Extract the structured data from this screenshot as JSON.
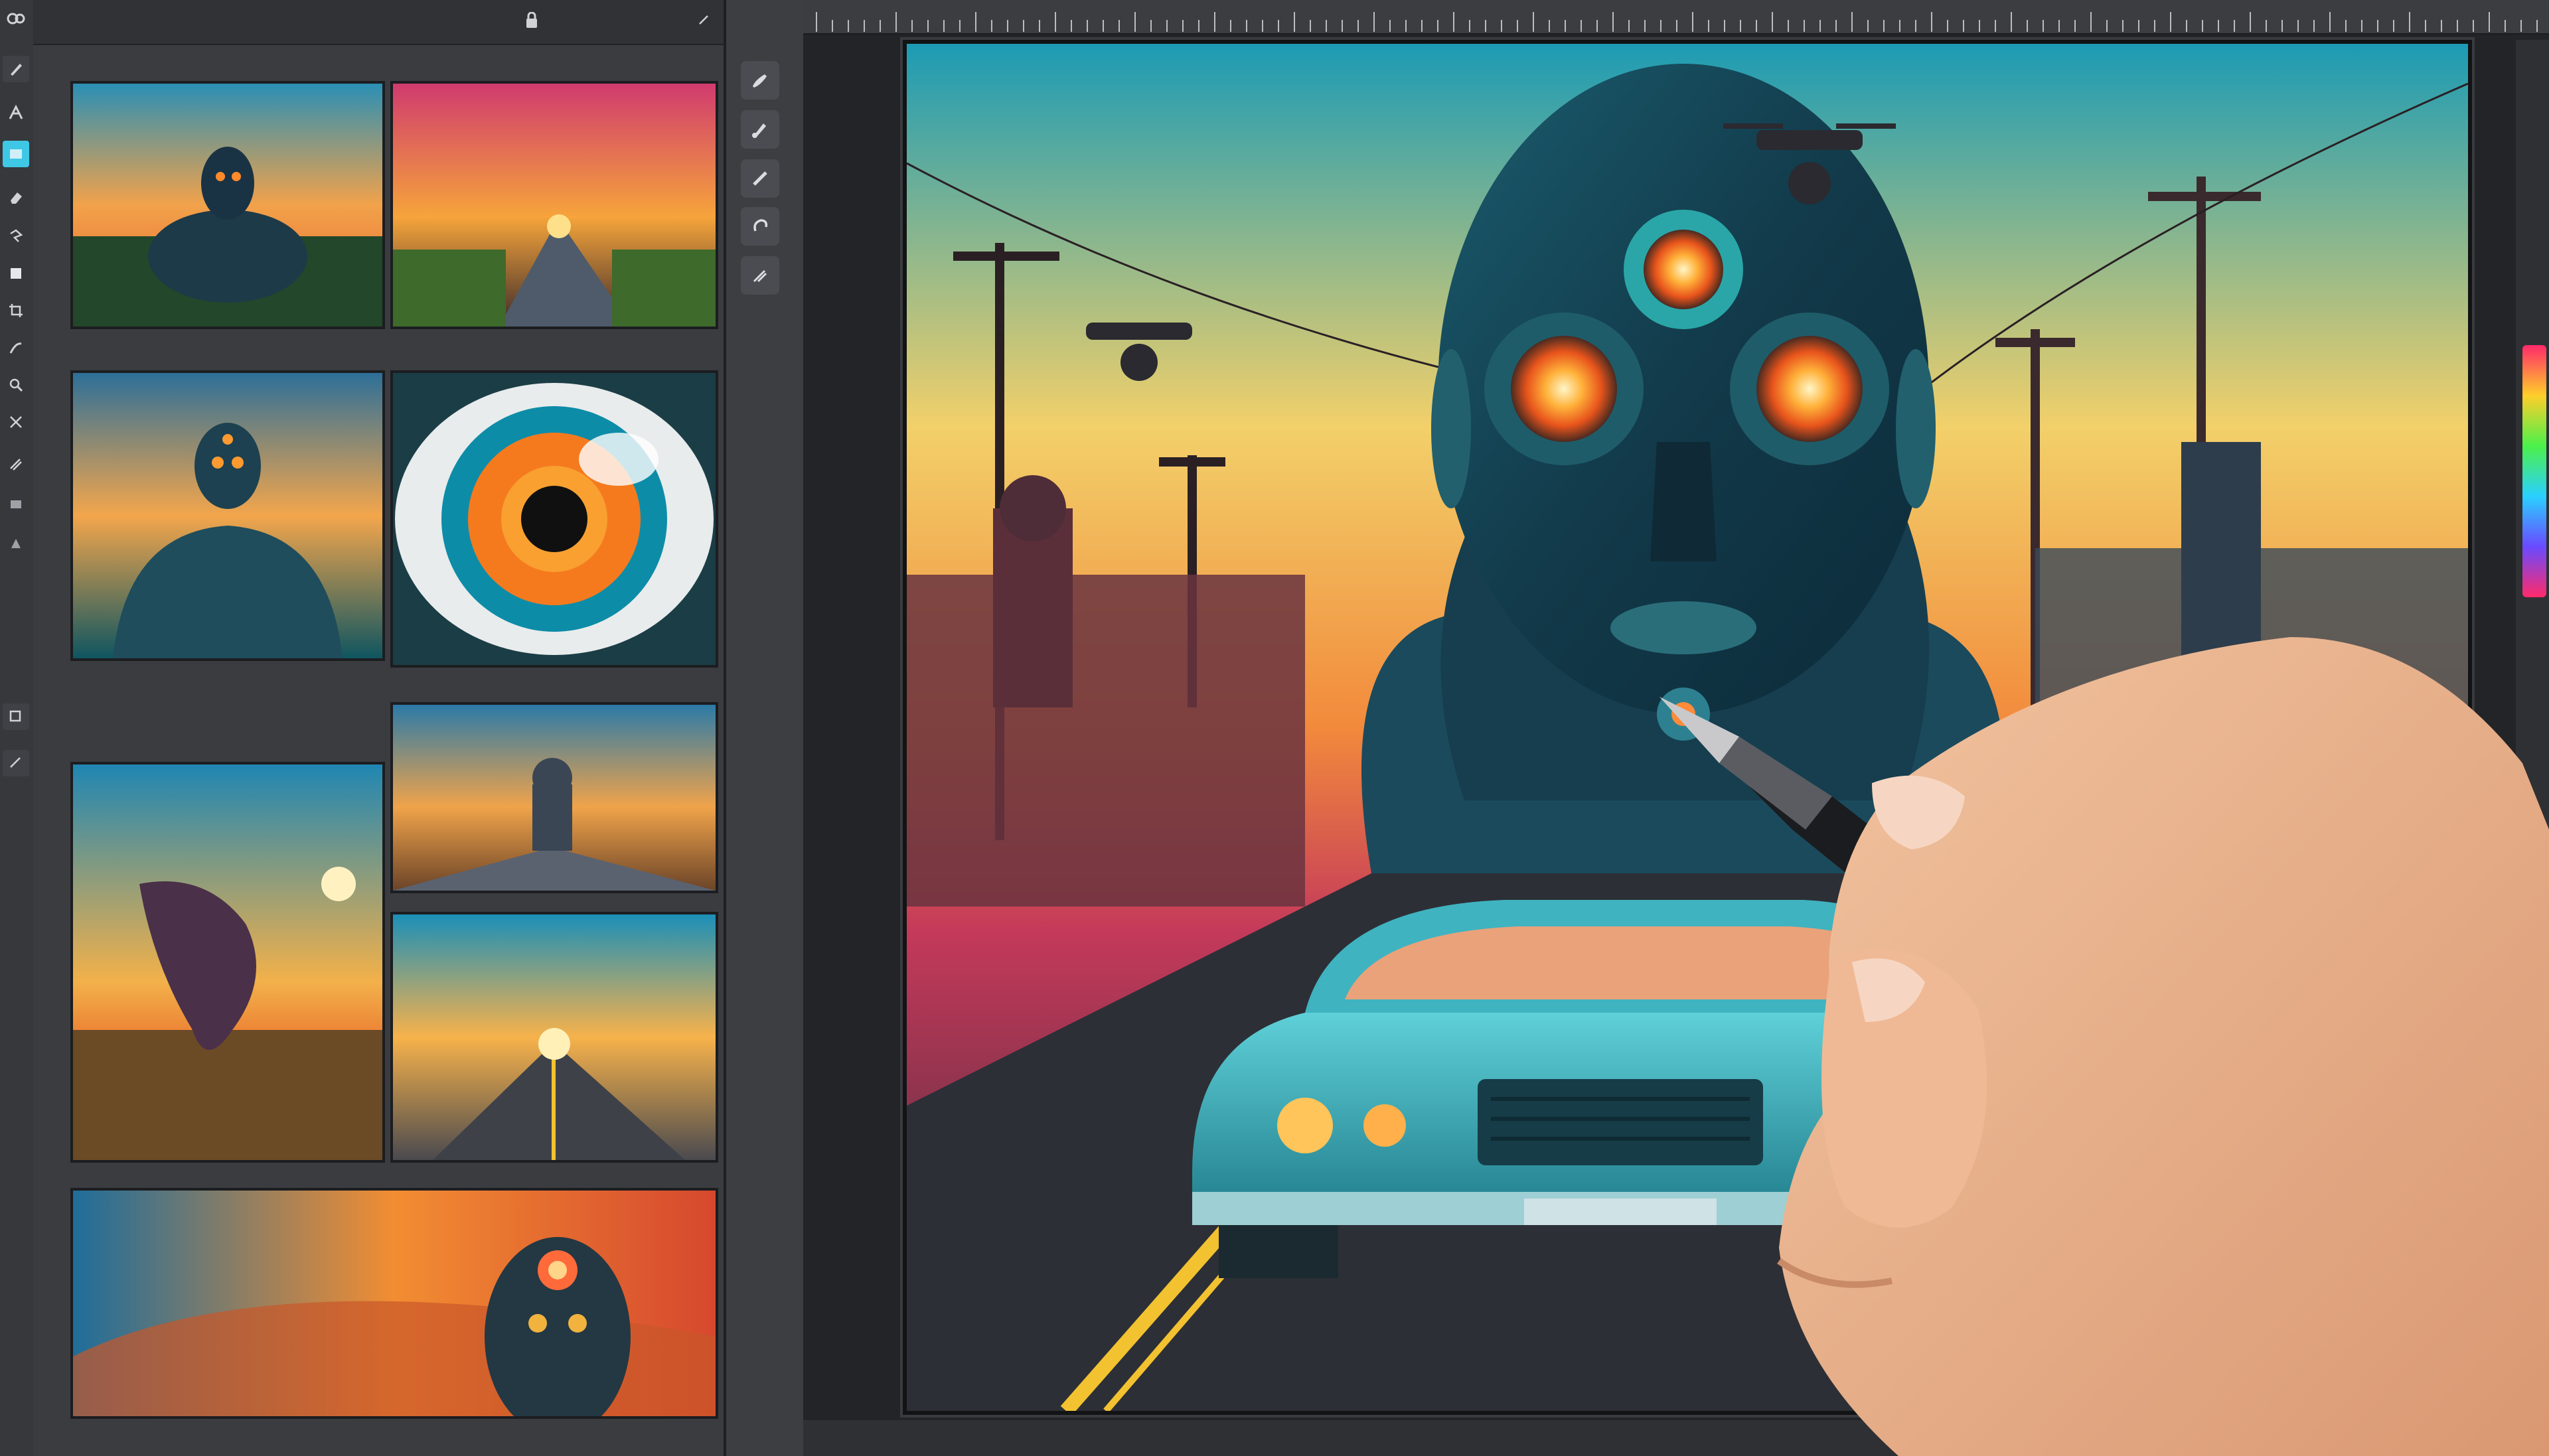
{
  "left_toolbar": {
    "tools": [
      "brush-icon",
      "pen-icon",
      "marquee-icon",
      "eraser-icon",
      "lasso-icon",
      "shape-icon",
      "crop-icon",
      "gradient-icon",
      "hand-icon",
      "zoom-icon"
    ]
  },
  "gallery": {
    "header": {
      "title": "",
      "menu": "",
      "lock": ""
    },
    "sections": [
      {
        "label": ""
      },
      {
        "label": ""
      },
      {
        "label": ""
      },
      {
        "label": ""
      },
      {
        "label": ""
      }
    ]
  },
  "tool_strip": {
    "tools": [
      "brush-icon",
      "smudge-icon",
      "pen-icon",
      "pencil-icon",
      "blend-icon"
    ]
  },
  "colors": {
    "accent": "#3fc7e6",
    "panel": "#3a3c40",
    "canvas_bg": "#232427"
  }
}
